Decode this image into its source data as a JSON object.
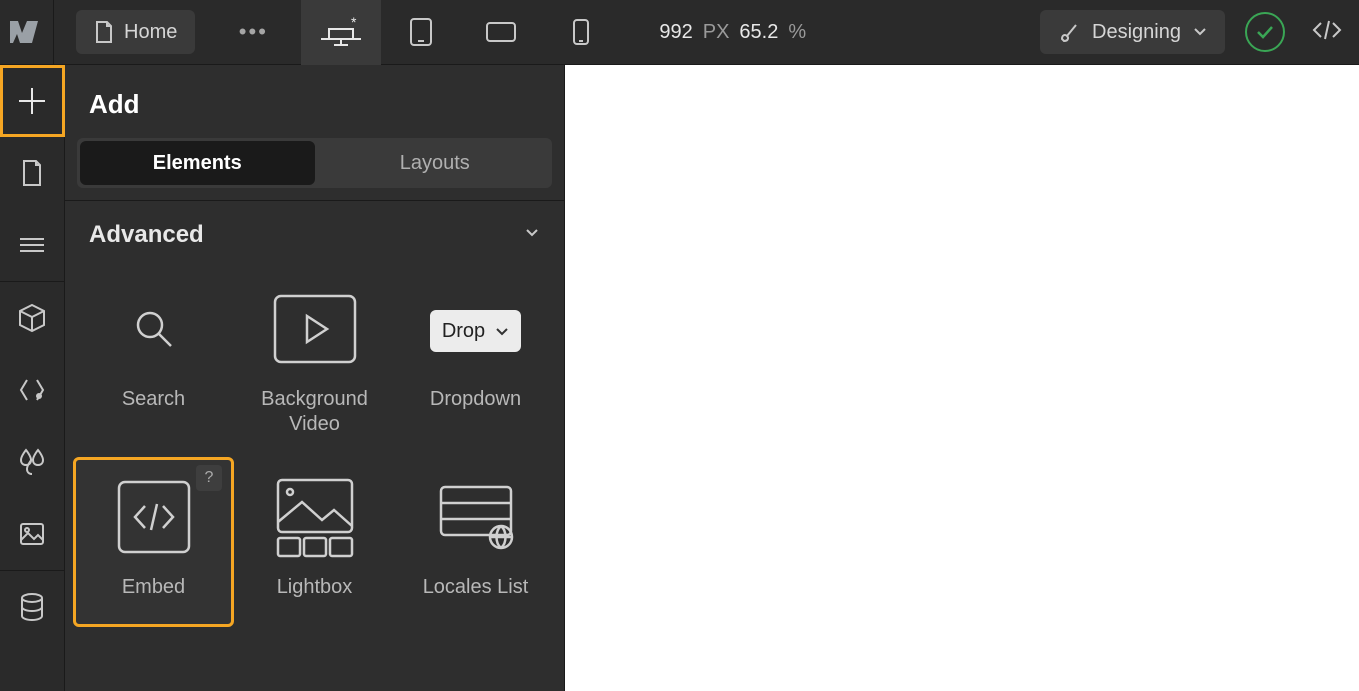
{
  "top": {
    "page_label": "Home",
    "size_value": "992",
    "size_unit": "PX",
    "zoom_value": "65.2",
    "zoom_unit": "%",
    "mode_label": "Designing"
  },
  "panel": {
    "title": "Add",
    "tabs": {
      "elements": "Elements",
      "layouts": "Layouts"
    },
    "section_title": "Advanced",
    "items": {
      "search": "Search",
      "bg_video": "Background Video",
      "dropdown": "Dropdown",
      "dropdown_combo": "Drop",
      "embed": "Embed",
      "lightbox": "Lightbox",
      "locales": "Locales List",
      "help": "?"
    }
  }
}
